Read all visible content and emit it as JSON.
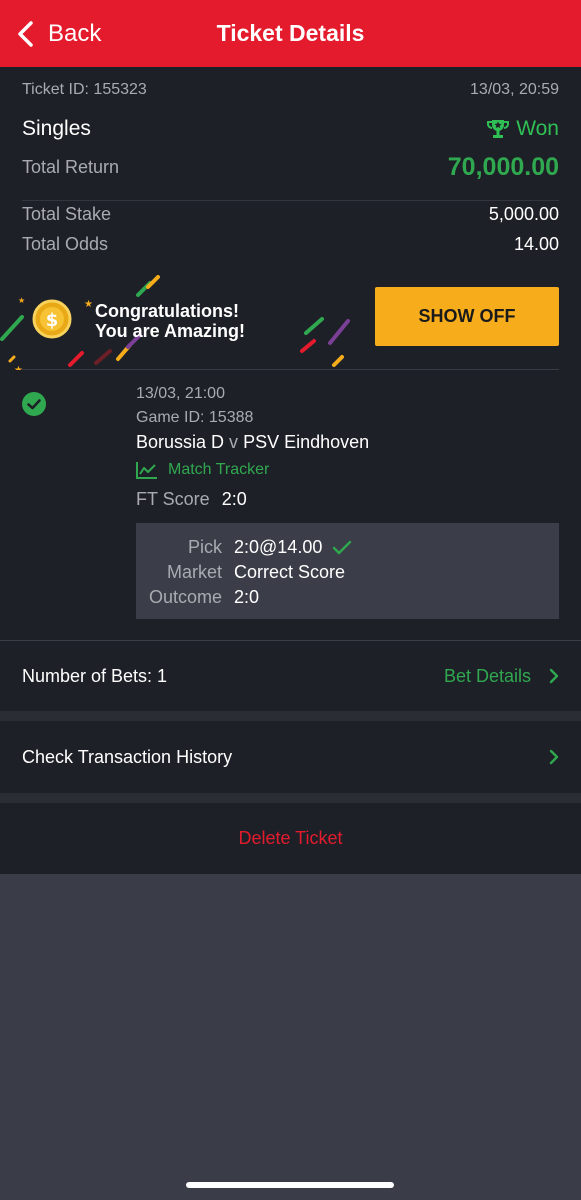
{
  "header": {
    "back_label": "Back",
    "title": "Ticket Details",
    "color": "#e41b2c"
  },
  "summary": {
    "ticket_id": "Ticket ID: 155323",
    "datetime": "13/03, 20:59",
    "bet_type": "Singles",
    "status": "Won",
    "status_icon": "trophy-icon",
    "total_return_label": "Total Return",
    "total_return": "70,000.00",
    "total_stake_label": "Total Stake",
    "total_stake": "5,000.00",
    "total_odds_label": "Total Odds",
    "total_odds": "14.00",
    "accent_green": "#2fa84f"
  },
  "promo": {
    "line1": "Congratulations!",
    "line2": "You are Amazing!",
    "button_label": "SHOW OFF",
    "button_color": "#f7ad1b"
  },
  "bet": {
    "time": "13/03, 21:00",
    "game_id": "Game ID: 15388",
    "home": "Borussia D",
    "vs": "v",
    "away": "PSV Eindhoven",
    "tracker_label": "Match Tracker",
    "ft_label": "FT Score",
    "ft_score": "2:0",
    "pick_label": "Pick",
    "pick_value": "2:0@14.00",
    "market_label": "Market",
    "market_value": "Correct Score",
    "outcome_label": "Outcome",
    "outcome_value": "2:0"
  },
  "footer_rows": {
    "number_of_bets": "Number of Bets: 1",
    "bet_details_label": "Bet Details",
    "transaction_history": "Check Transaction History",
    "delete_label": "Delete Ticket"
  }
}
